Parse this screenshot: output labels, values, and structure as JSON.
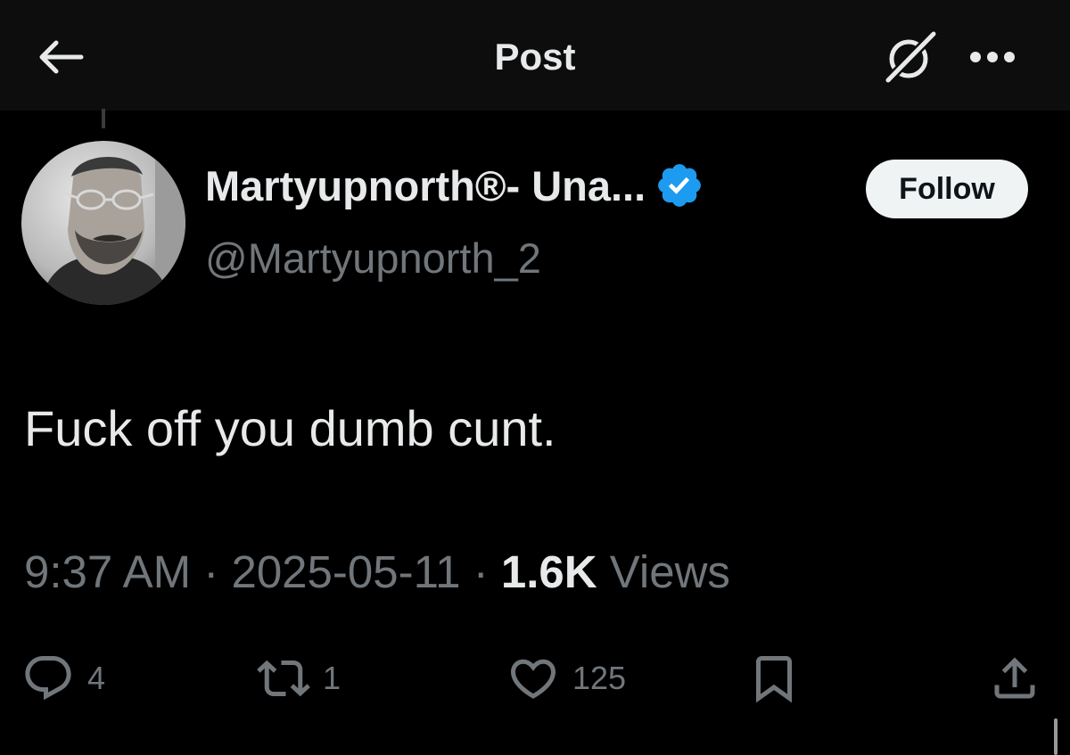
{
  "header": {
    "title": "Post",
    "back_icon": "arrow-left-icon",
    "grok_icon": "grok-icon",
    "more_icon": "more-horizontal-icon"
  },
  "post": {
    "display_name": "Martyupnorth®- Una...",
    "handle": "@Martyupnorth_2",
    "verified": true,
    "follow_label": "Follow",
    "text": "Fuck off you dumb cunt.",
    "time": "9:37 AM",
    "date": "2025-05-11",
    "separator": "·",
    "views_count": "1.6K",
    "views_label": "Views"
  },
  "actions": {
    "replies": "4",
    "reposts": "1",
    "likes": "125"
  },
  "colors": {
    "background": "#000000",
    "topbar": "#0d0d0d",
    "text_primary": "#e7e9ea",
    "text_secondary": "#71767b",
    "verified_blue": "#1d9bf0",
    "follow_bg": "#eff3f4"
  }
}
